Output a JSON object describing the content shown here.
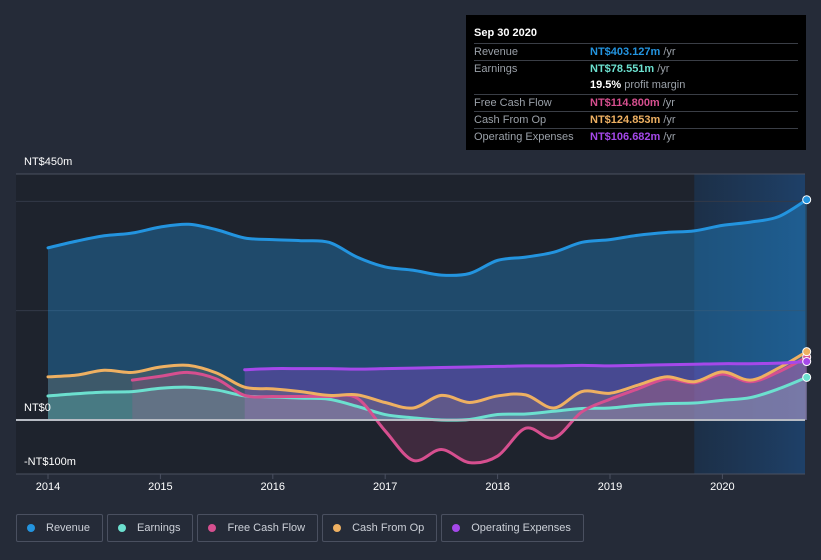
{
  "tooltip": {
    "date": "Sep 30 2020",
    "rows": [
      {
        "label": "Revenue",
        "value": "NT$403.127m",
        "unit": "/yr",
        "color": "#2394df"
      },
      {
        "label": "Earnings",
        "value": "NT$78.551m",
        "unit": "/yr",
        "color": "#6ce0cf"
      },
      {
        "label": "",
        "value": "19.5%",
        "unit": "profit margin",
        "color": "#ffffff"
      },
      {
        "label": "Free Cash Flow",
        "value": "NT$114.800m",
        "unit": "/yr",
        "color": "#d64f8f"
      },
      {
        "label": "Cash From Op",
        "value": "NT$124.853m",
        "unit": "/yr",
        "color": "#eeb062"
      },
      {
        "label": "Operating Expenses",
        "value": "NT$106.682m",
        "unit": "/yr",
        "color": "#a548ea"
      }
    ]
  },
  "legend": [
    {
      "label": "Revenue",
      "color": "#2394df"
    },
    {
      "label": "Earnings",
      "color": "#6ce0cf"
    },
    {
      "label": "Free Cash Flow",
      "color": "#d64f8f"
    },
    {
      "label": "Cash From Op",
      "color": "#eeb062"
    },
    {
      "label": "Operating Expenses",
      "color": "#a548ea"
    }
  ],
  "chart_data": {
    "type": "area",
    "title": "",
    "xlabel": "",
    "ylabel": "",
    "y_tick_labels": [
      "NT$450m",
      "NT$0",
      "-NT$100m"
    ],
    "y_ticks": [
      450,
      0,
      -100
    ],
    "ylim": [
      -100,
      450
    ],
    "x_tick_labels": [
      "2014",
      "2015",
      "2016",
      "2017",
      "2018",
      "2019",
      "2020"
    ],
    "x_ticks": [
      2014,
      2015,
      2016,
      2017,
      2018,
      2019,
      2020
    ],
    "xlim": [
      2013.7,
      2020.75
    ],
    "forecast_shade_from": 2019.75,
    "grid": true,
    "legend_position": "bottom",
    "series": [
      {
        "name": "Revenue",
        "color": "#2394df",
        "x": [
          2014.0,
          2014.25,
          2014.5,
          2014.75,
          2015.0,
          2015.25,
          2015.5,
          2015.75,
          2016.0,
          2016.25,
          2016.5,
          2016.75,
          2017.0,
          2017.25,
          2017.5,
          2017.75,
          2018.0,
          2018.25,
          2018.5,
          2018.75,
          2019.0,
          2019.25,
          2019.5,
          2019.75,
          2020.0,
          2020.25,
          2020.5,
          2020.75
        ],
        "y": [
          315,
          327,
          337,
          342,
          353,
          358,
          348,
          333,
          330,
          328,
          325,
          298,
          280,
          274,
          265,
          268,
          292,
          298,
          307,
          325,
          330,
          338,
          343,
          346,
          356,
          362,
          372,
          403
        ]
      },
      {
        "name": "Earnings",
        "color": "#6ce0cf",
        "x": [
          2014.0,
          2014.25,
          2014.5,
          2014.75,
          2015.0,
          2015.25,
          2015.5,
          2015.75,
          2016.0,
          2016.25,
          2016.5,
          2016.75,
          2017.0,
          2017.25,
          2017.5,
          2017.75,
          2018.0,
          2018.25,
          2018.5,
          2018.75,
          2019.0,
          2019.25,
          2019.5,
          2019.75,
          2020.0,
          2020.25,
          2020.5,
          2020.75
        ],
        "y": [
          44,
          48,
          51,
          52,
          58,
          60,
          55,
          44,
          42,
          40,
          38,
          25,
          10,
          4,
          0,
          1,
          10,
          11,
          16,
          21,
          22,
          27,
          30,
          31,
          36,
          41,
          57,
          78
        ]
      },
      {
        "name": "Free Cash Flow",
        "color": "#d64f8f",
        "x": [
          2014.75,
          2015.0,
          2015.25,
          2015.5,
          2015.75,
          2016.0,
          2016.25,
          2016.5,
          2016.75,
          2017.0,
          2017.25,
          2017.5,
          2017.75,
          2018.0,
          2018.25,
          2018.5,
          2018.75,
          2019.0,
          2019.25,
          2019.5,
          2019.75,
          2020.0,
          2020.25,
          2020.5,
          2020.75
        ],
        "y": [
          73,
          80,
          87,
          75,
          45,
          43,
          43,
          43,
          40,
          -20,
          -74,
          -54,
          -78,
          -66,
          -15,
          -33,
          15,
          38,
          57,
          75,
          68,
          84,
          70,
          88,
          115
        ]
      },
      {
        "name": "Cash From Op",
        "color": "#eeb062",
        "x": [
          2014.0,
          2014.25,
          2014.5,
          2014.75,
          2015.0,
          2015.25,
          2015.5,
          2015.75,
          2016.0,
          2016.25,
          2016.5,
          2016.75,
          2017.0,
          2017.25,
          2017.5,
          2017.75,
          2018.0,
          2018.25,
          2018.5,
          2018.75,
          2019.0,
          2019.25,
          2019.5,
          2019.75,
          2020.0,
          2020.25,
          2020.5,
          2020.75
        ],
        "y": [
          79,
          82,
          91,
          87,
          97,
          100,
          86,
          60,
          57,
          52,
          45,
          46,
          32,
          22,
          45,
          32,
          44,
          46,
          22,
          52,
          49,
          64,
          79,
          70,
          88,
          73,
          95,
          125
        ]
      },
      {
        "name": "Operating Expenses",
        "color": "#a548ea",
        "x": [
          2015.75,
          2016.0,
          2016.25,
          2016.5,
          2016.75,
          2017.0,
          2017.25,
          2017.5,
          2017.75,
          2018.0,
          2018.25,
          2018.5,
          2018.75,
          2019.0,
          2019.25,
          2019.5,
          2019.75,
          2020.0,
          2020.25,
          2020.5,
          2020.75
        ],
        "y": [
          92,
          94,
          94,
          94,
          93,
          94,
          95,
          96,
          97,
          98,
          99,
          99,
          100,
          99,
          100,
          101,
          102,
          103,
          103,
          104,
          107
        ]
      }
    ]
  }
}
